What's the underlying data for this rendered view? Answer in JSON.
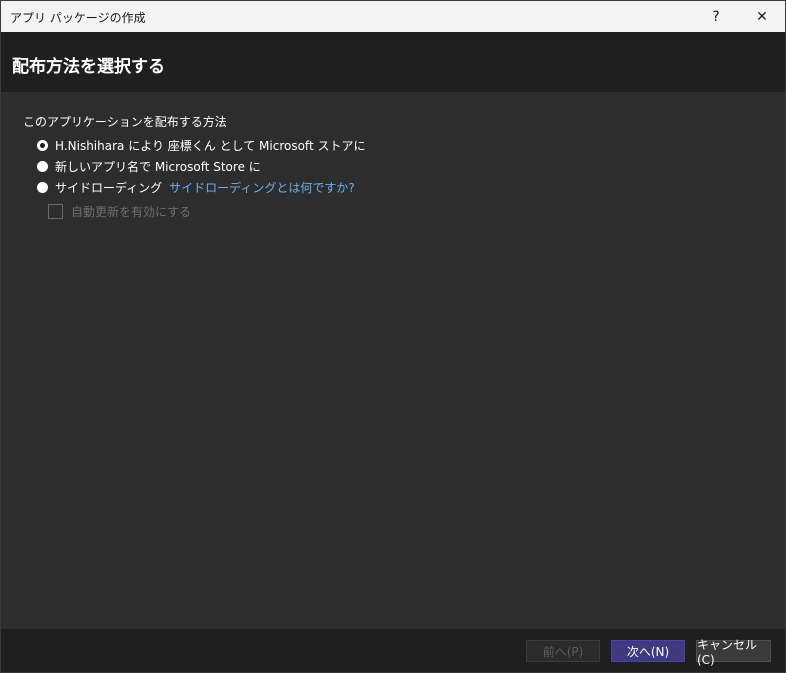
{
  "window": {
    "title": "アプリ パッケージの作成",
    "help_label": "?",
    "close_label": "✕"
  },
  "header": {
    "title": "配布方法を選択する"
  },
  "distribution": {
    "group_label": "このアプリケーションを配布する方法",
    "options": [
      {
        "label": "H.Nishihara により 座標くん として Microsoft ストアに",
        "selected": true
      },
      {
        "label": "新しいアプリ名で Microsoft Store に",
        "selected": false
      },
      {
        "label": "サイドローディング",
        "selected": false,
        "link": "サイドローディングとは何ですか?"
      }
    ],
    "auto_update_label": "自動更新を有効にする",
    "auto_update_enabled": false
  },
  "footer": {
    "prev_label": "前へ(P)",
    "next_label": "次へ(N)",
    "cancel_label": "キャンセル(C)"
  },
  "colors": {
    "accent": "#3e3a7d",
    "link": "#6bb0f0",
    "background": "#2d2d2d",
    "header_bg": "#1f1f1f"
  }
}
